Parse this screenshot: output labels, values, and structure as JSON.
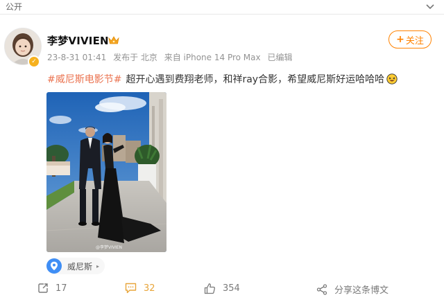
{
  "top": {
    "visibility_label": "公开"
  },
  "user": {
    "name": "李梦VIVIEN",
    "timestamp": "23-8-31 01:41",
    "published_from_label": "发布于 北京",
    "device_label": "来自 iPhone 14 Pro Max",
    "edited_label": "已编辑"
  },
  "follow": {
    "label": "关注"
  },
  "post": {
    "hashtag": "#威尼斯电影节#",
    "text": "超开心遇到费翔老师，和祥ray合影，希望威尼斯好运哈哈哈"
  },
  "photo": {
    "watermark": "@李梦VIVIEN"
  },
  "location": {
    "label": "威尼斯"
  },
  "actions": {
    "repost_count": "17",
    "comment_count": "32",
    "like_count": "354",
    "share_label": "分享这条博文"
  },
  "colors": {
    "accent_orange": "#ff8200",
    "hashtag": "#eb7350",
    "comment_active": "#e8a53a",
    "location_icon": "#3f8ef5"
  },
  "icons": {
    "top_right": "chevron-down-icon",
    "crown": "crown-icon",
    "verified": "verified-badge-icon",
    "emoji": "laughing-emoji-icon",
    "location": "location-pin-icon",
    "repost": "repost-icon",
    "comment": "comment-icon",
    "like": "like-icon",
    "share": "share-icon"
  }
}
